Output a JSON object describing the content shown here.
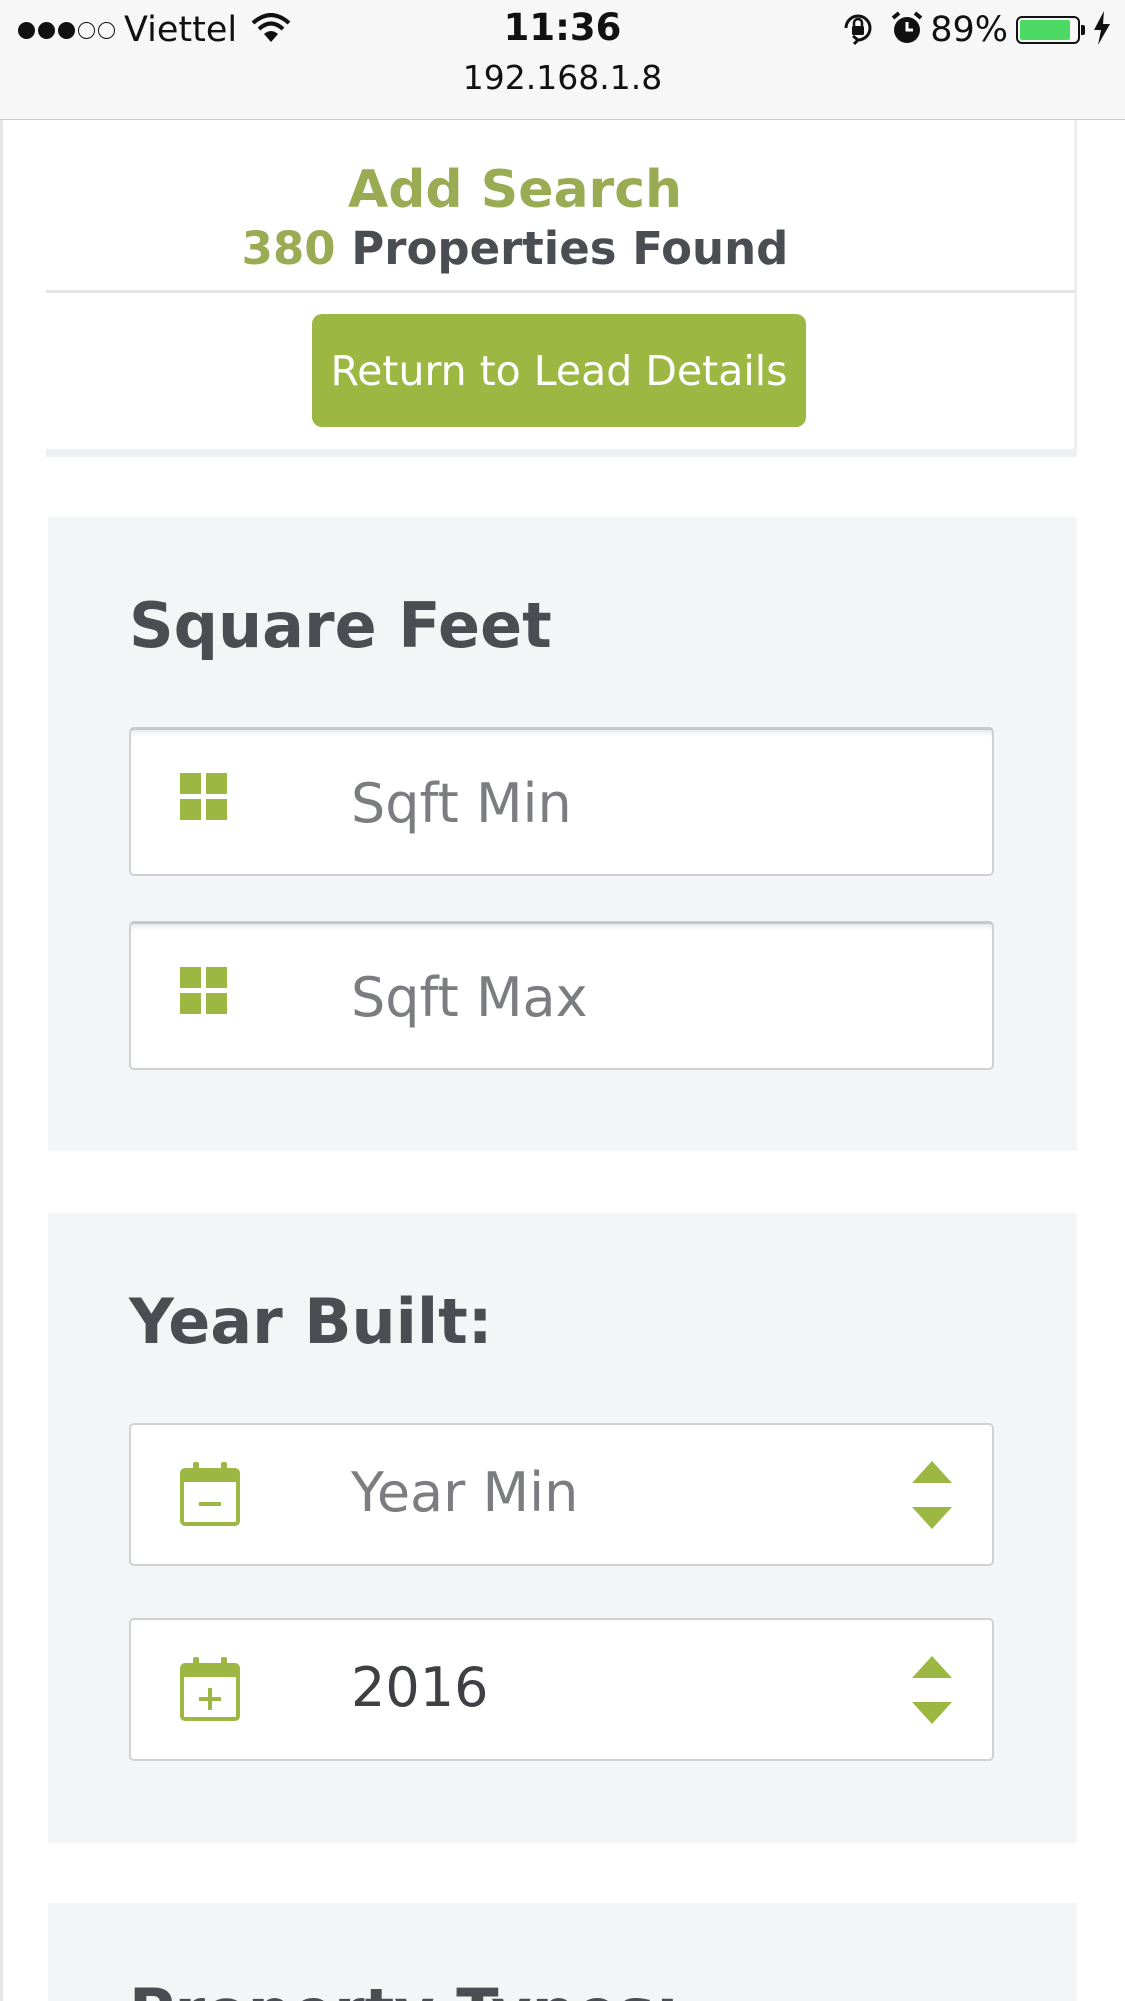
{
  "status_bar": {
    "carrier": "Viettel",
    "time": "11:36",
    "url": "192.168.1.8",
    "battery_percent": "89%",
    "battery_level": 0.89,
    "signal_bars": 3,
    "signal_total": 5,
    "icons": [
      "wifi-icon",
      "orientation-lock-icon",
      "alarm-icon",
      "battery-icon",
      "charging-bolt-icon"
    ]
  },
  "header": {
    "title": "Add Search",
    "count": "380",
    "count_suffix": "Properties Found",
    "return_button": "Return to Lead Details"
  },
  "square_feet": {
    "title": "Square Feet",
    "min_placeholder": "Sqft Min",
    "max_placeholder": "Sqft Max",
    "icon": "grid-icon"
  },
  "year_built": {
    "title": "Year Built:",
    "min_placeholder": "Year Min",
    "max_value": "2016",
    "min_icon": "calendar-minus-icon",
    "max_icon": "calendar-plus-icon"
  },
  "property_types": {
    "title": "Property Types:"
  },
  "colors": {
    "accent": "#9cb842",
    "heading_accent": "#9aac53",
    "text": "#4a4d52",
    "section_bg": "#f4f5f7"
  }
}
